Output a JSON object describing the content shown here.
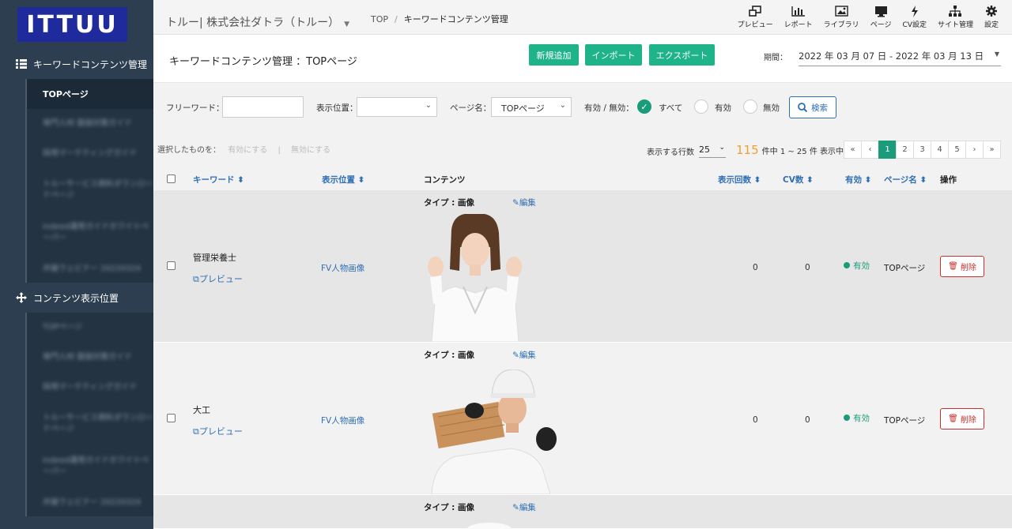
{
  "sidebar": {
    "logo": "ITTUU",
    "sections": [
      {
        "label": "キーワードコンテンツ管理",
        "items": [
          "TOPページ",
          "専門人材 面接対策ガイド",
          "採用マーケティングガイド",
          "トルーサービス資料ダウンロードページ",
          "indeed運用ガイドホワイトペーパー",
          "共催ウェビナー 20220324"
        ]
      },
      {
        "label": "コンテンツ表示位置",
        "items": [
          "TOPページ",
          "専門人材 面接対策ガイド",
          "採用マーケティングガイド",
          "トルーサービス資料ダウンロードページ",
          "indeed運用ガイドホワイトペーパー",
          "共催ウェビナー 20220324"
        ]
      }
    ]
  },
  "header": {
    "company": "トルー| 株式会社ダトラ（トルー）",
    "breadcrumb": [
      "TOP",
      "キーワードコンテンツ管理"
    ],
    "icons": [
      {
        "label": "プレビュー",
        "icon": "preview-icon"
      },
      {
        "label": "レポート",
        "icon": "report-icon"
      },
      {
        "label": "ライブラリ",
        "icon": "library-icon"
      },
      {
        "label": "ページ",
        "icon": "page-icon"
      },
      {
        "label": "CV設定",
        "icon": "cv-icon"
      },
      {
        "label": "サイト管理",
        "icon": "sitemap-icon"
      },
      {
        "label": "設定",
        "icon": "gear-icon"
      }
    ]
  },
  "titlebar": {
    "title": "キーワードコンテンツ管理 ：TOPページ",
    "buttons": {
      "new": "新規追加",
      "import": "インポート",
      "export": "エクスポート"
    },
    "period_label": "期間：",
    "period_value": "2022 年 03 月 07 日 - 2022 年 03 月 13 日"
  },
  "filters": {
    "freeword_label": "フリーワード：",
    "position_label": "表示位置：",
    "pagename_label": "ページ名：",
    "pagename_value": "TOPページ",
    "status_label": "有効 / 無効：",
    "status_options": [
      "すべて",
      "有効",
      "無効"
    ],
    "status_selected": "すべて",
    "search": "検索"
  },
  "bulk": {
    "label": "選択したものを：",
    "enable": "有効にする",
    "separator": "|",
    "disable": "無効にする"
  },
  "pagination": {
    "rows_label": "表示する行数",
    "rows_value": "25",
    "total": "115",
    "range_text": "件中 1 ~ 25 件 表示中",
    "pages": [
      "«",
      "‹",
      "1",
      "2",
      "3",
      "4",
      "5",
      "›",
      "»"
    ],
    "current": "1"
  },
  "table": {
    "headers": {
      "keyword": "キーワード",
      "position": "表示位置",
      "content": "コンテンツ",
      "views": "表示回数",
      "cv": "CV数",
      "valid": "有効",
      "pagename": "ページ名",
      "actions": "操作"
    },
    "rows": [
      {
        "keyword": "管理栄養士",
        "preview": "プレビュー",
        "position": "FV人物画像",
        "type": "タイプ : 画像",
        "edit": "編集",
        "views": "0",
        "cv": "0",
        "valid": "有効",
        "pagename": "TOPページ",
        "delete": "削除"
      },
      {
        "keyword": "大工",
        "preview": "プレビュー",
        "position": "FV人物画像",
        "type": "タイプ : 画像",
        "edit": "編集",
        "views": "0",
        "cv": "0",
        "valid": "有効",
        "pagename": "TOPページ",
        "delete": "削除"
      },
      {
        "type": "タイプ : 画像",
        "edit": "編集"
      }
    ]
  },
  "colors": {
    "accent": "#1fb38a",
    "link": "#2f6fb4",
    "sidebar": "#2c3e50",
    "logo_bg": "#1f2b9c",
    "count": "#f0a033",
    "danger": "#c9302c"
  }
}
